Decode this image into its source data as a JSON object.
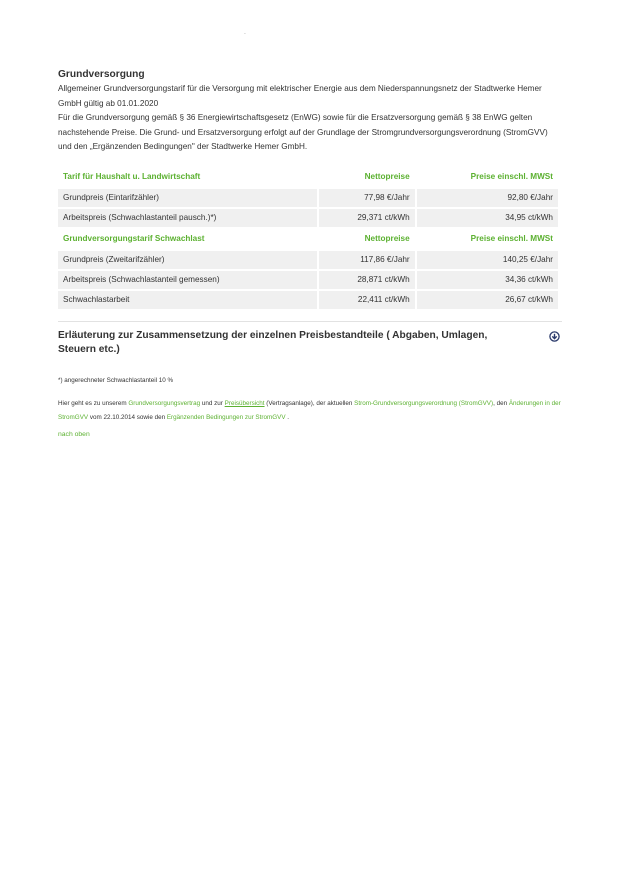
{
  "header": {
    "dot": "`"
  },
  "section": {
    "title": "Grundversorgung",
    "para1": "Allgemeiner Grundversorgungstarif für die Versorgung mit elektrischer Energie aus dem Niederspannungsnetz der Stadtwerke Hemer GmbH gültig ab 01.01.2020",
    "para2": "Für die Grundversorgung gemäß § 36 Energiewirtschaftsgesetz (EnWG) sowie für die Ersatzversorgung gemäß § 38 EnWG gelten nachstehende Preise. Die Grund- und Ersatzversorgung erfolgt auf der Grundlage der Stromgrundversorgungsverordnung (StromGVV) und den „Ergänzenden Bedingungen\" der Stadtwerke Hemer GmbH."
  },
  "table1": {
    "headers": [
      "Tarif für Haushalt u. Landwirtschaft",
      "Nettopreise",
      "Preise einschl. MWSt"
    ],
    "rows": [
      [
        "Grundpreis (Eintarifzähler)",
        "77,98 €/Jahr",
        "92,80 €/Jahr"
      ],
      [
        "Arbeitspreis (Schwachlastanteil pausch.)*)",
        "29,371 ct/kWh",
        "34,95 ct/kWh"
      ]
    ]
  },
  "table2": {
    "headers": [
      "Grundversorgungstarif Schwachlast",
      "Nettopreise",
      "Preise einschl. MWSt"
    ],
    "rows": [
      [
        "Grundpreis (Zweitarifzähler)",
        "117,86 €/Jahr",
        "140,25 €/Jahr"
      ],
      [
        "Arbeitspreis (Schwachlastanteil gemessen)",
        "28,871 ct/kWh",
        "34,36 ct/kWh"
      ],
      [
        "Schwachlastarbeit",
        "22,411 ct/kWh",
        "26,67 ct/kWh"
      ]
    ]
  },
  "accordion": {
    "title": "Erläuterung zur Zusammensetzung der einzelnen Preisbestandteile ( Abgaben, Umlagen, Steuern etc.)",
    "icon": "circle-arrow-down-icon"
  },
  "footnote": "*) angerechneter Schwachlastanteil 10 %",
  "links_para": {
    "t1": "Hier geht es zu unserem ",
    "link1": "Grundversorgungsvertrag",
    "t2": " und zur ",
    "link2": "Preisübersicht",
    "t3": " (Vertragsanlage), der aktuellen ",
    "link3": "Strom-Grundversorgungsverordnung (StromGVV)",
    "t4": ", den ",
    "link4": "Änderungen in der StromGVV",
    "t5": "  vom 22.10.2014 sowie den ",
    "link5": "Ergänzenden Bedingungen zur StromGVV",
    "t6": " ."
  },
  "top_link": "nach oben",
  "colors": {
    "accent": "#5cb131",
    "text": "#333333",
    "row_bg": "#f0f0f0"
  }
}
